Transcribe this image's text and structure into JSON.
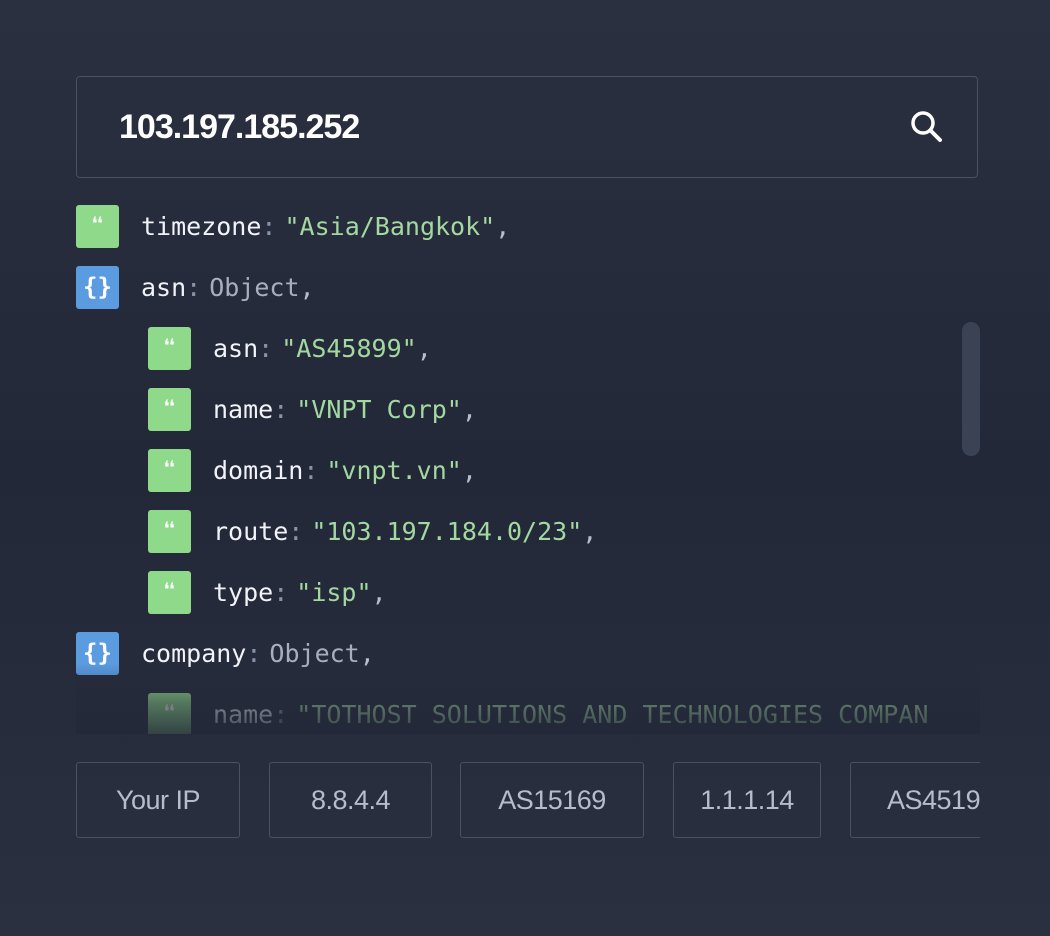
{
  "search": {
    "value": "103.197.185.252",
    "icon": "search-icon"
  },
  "json_viewer": {
    "rows": [
      {
        "type": "string",
        "key": "timezone",
        "value": "\"Asia/Bangkok\"",
        "comma": ","
      },
      {
        "type": "object",
        "key": "asn",
        "value": "Object",
        "comma": ","
      },
      {
        "type": "string",
        "key": "asn",
        "value": "\"AS45899\"",
        "comma": ","
      },
      {
        "type": "string",
        "key": "name",
        "value": "\"VNPT Corp\"",
        "comma": ","
      },
      {
        "type": "string",
        "key": "domain",
        "value": "\"vnpt.vn\"",
        "comma": ","
      },
      {
        "type": "string",
        "key": "route",
        "value": "\"103.197.184.0/23\"",
        "comma": ","
      },
      {
        "type": "string",
        "key": "type",
        "value": "\"isp\"",
        "comma": ","
      },
      {
        "type": "object",
        "key": "company",
        "value": "Object",
        "comma": ","
      },
      {
        "type": "string",
        "key": "name",
        "value": "\"TOTHOST SOLUTIONS AND TECHNOLOGIES COMPAN",
        "comma": ""
      }
    ],
    "badge_glyphs": {
      "string": "❝",
      "object": "{}"
    },
    "colors": {
      "string_badge": "#8fd98a",
      "object_badge": "#5b9be0",
      "string_value": "#a3d9a0"
    }
  },
  "quick_links": [
    {
      "label": "Your IP"
    },
    {
      "label": "8.8.4.4"
    },
    {
      "label": "AS15169"
    },
    {
      "label": "1.1.1.14"
    },
    {
      "label": "AS4519"
    }
  ]
}
